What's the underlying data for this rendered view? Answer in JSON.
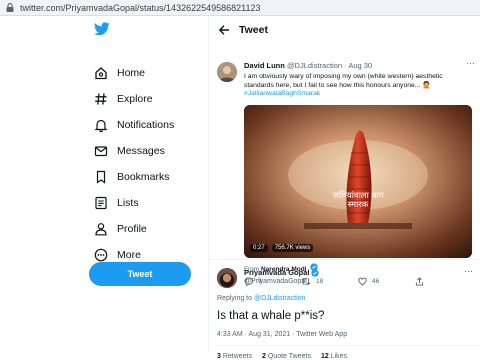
{
  "browser": {
    "url": "twitter.com/PriyamvadaGopal/status/1432622549586821123"
  },
  "sidebar": {
    "items": [
      {
        "label": "Home",
        "icon": "home-icon"
      },
      {
        "label": "Explore",
        "icon": "hashtag-icon"
      },
      {
        "label": "Notifications",
        "icon": "bell-icon"
      },
      {
        "label": "Messages",
        "icon": "envelope-icon"
      },
      {
        "label": "Bookmarks",
        "icon": "bookmark-icon"
      },
      {
        "label": "Lists",
        "icon": "list-icon"
      },
      {
        "label": "Profile",
        "icon": "person-icon"
      },
      {
        "label": "More",
        "icon": "more-circle-icon"
      }
    ],
    "tweet_button": "Tweet"
  },
  "header": {
    "title": "Tweet"
  },
  "quoted_tweet": {
    "author_name": "David Lunn",
    "handle": "@DJLdistraction",
    "dot": "·",
    "date": "Aug 30",
    "text": "I am obviously wary of imposing my own (white western) aesthetic standards here, but I fail to see how this honours anyone... 🤦",
    "hashtag": "#JallianwalaBaghSmarak",
    "video": {
      "duration": "0:27",
      "views": "756.7K views",
      "overlay_text": "जलियांवाला बाग स्मारक"
    },
    "from_prefix": "From",
    "from_account": "Narendra Modi",
    "actions": {
      "replies": "9",
      "retweets": "18",
      "likes": "46"
    }
  },
  "main_tweet": {
    "author_name": "Priyamvada Gopal",
    "handle": "@PriyamvadaGopal",
    "replying_prefix": "Replying to",
    "replying_to": "@DJLdistraction",
    "text": "Is that a whale p**is?",
    "timestamp": "4:33 AM · Aug 31, 2021 · Twitter Web App",
    "stats": {
      "retweets_count": "3",
      "retweets_label": "Retweets",
      "quotes_count": "2",
      "quotes_label": "Quote Tweets",
      "likes_count": "12",
      "likes_label": "Likes"
    }
  },
  "colors": {
    "accent": "#1d9bf0",
    "text": "#0f1419",
    "secondary": "#536471"
  }
}
